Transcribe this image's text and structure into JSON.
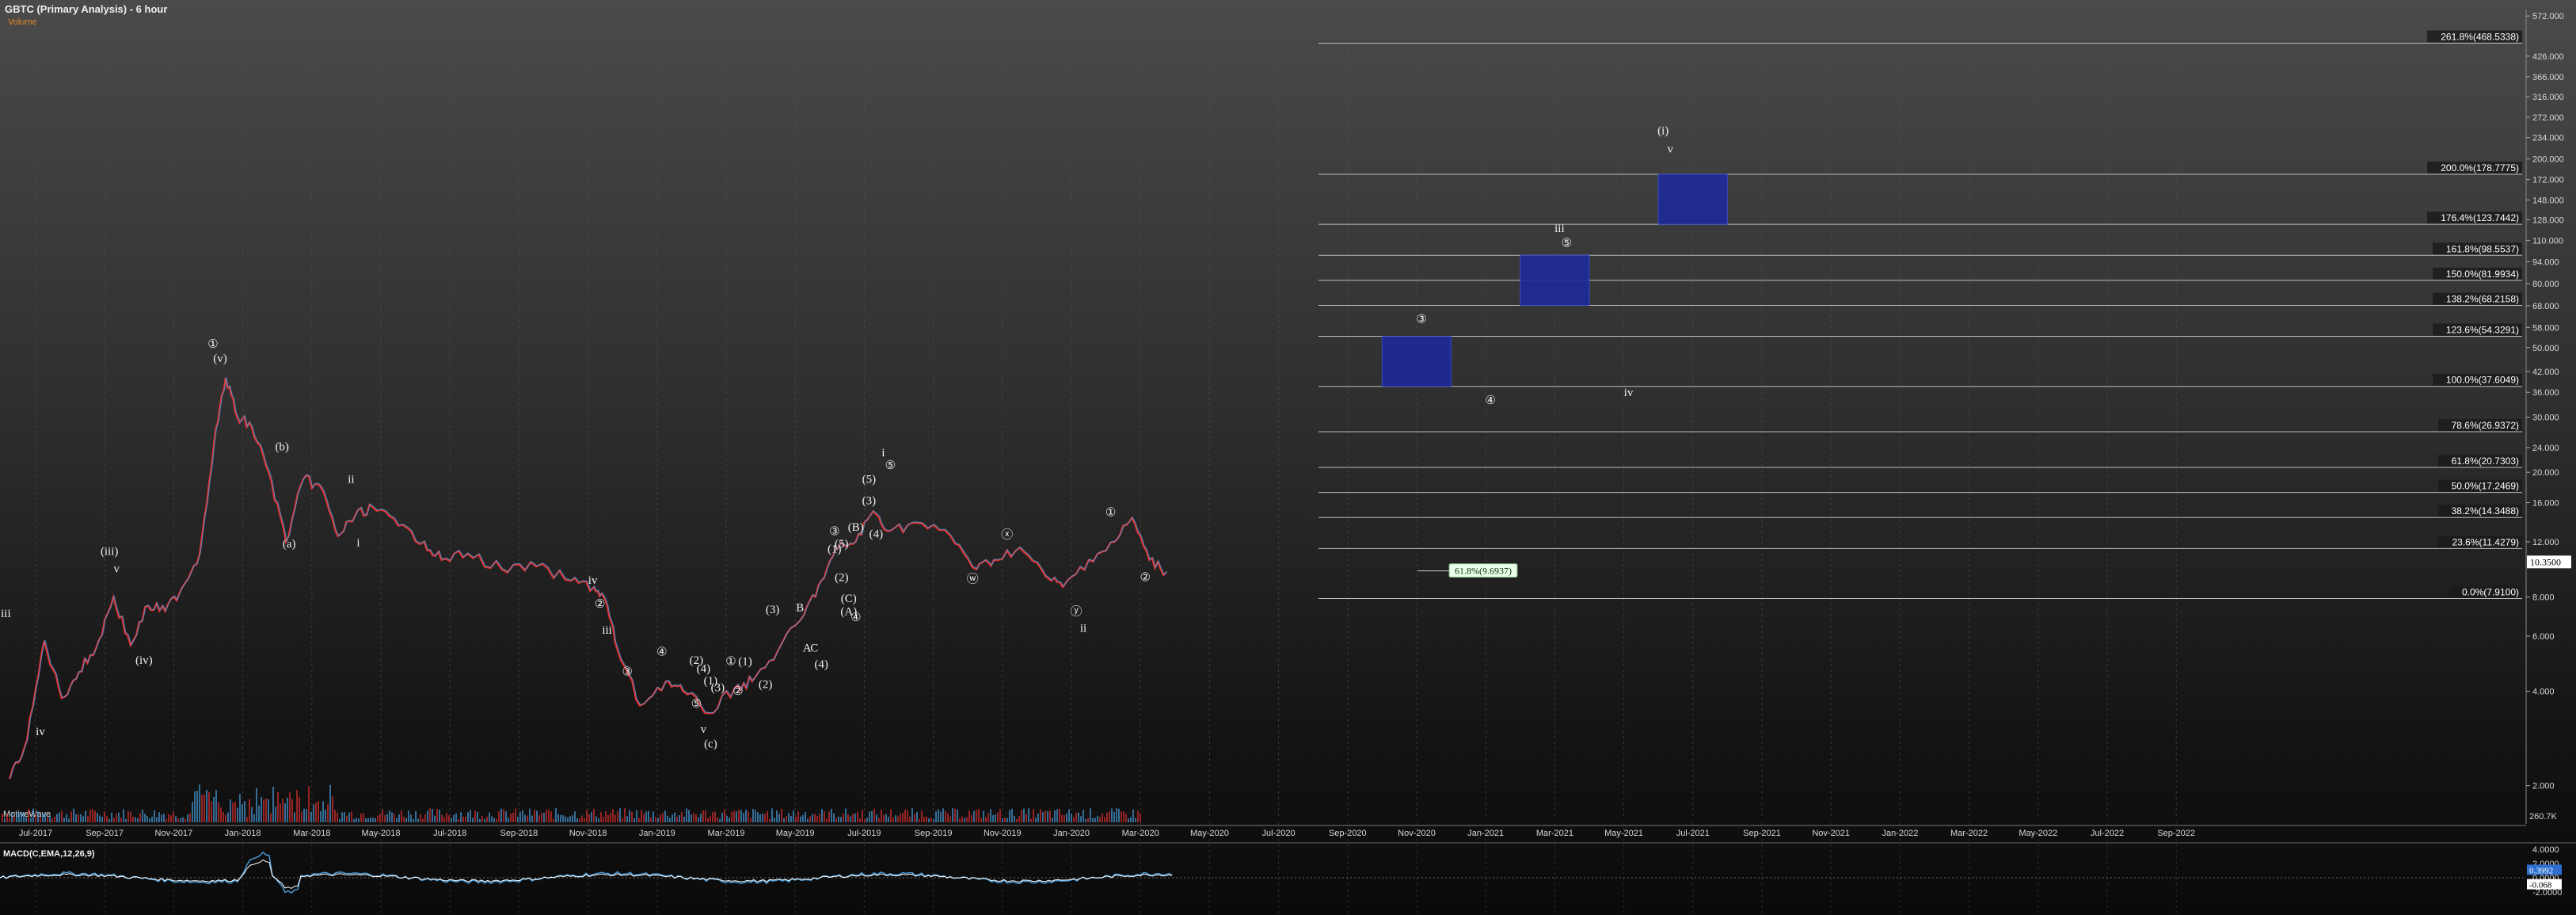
{
  "header": {
    "title": "GBTC (Primary Analysis) - 6 hour",
    "subtitle": "Volume",
    "volume_label": "MotiveWave",
    "macd_label": "MACD(C,EMA,12,26,9)"
  },
  "colors": {
    "up": "#4aa0e0",
    "down": "#e03030",
    "grid": "#555555",
    "fib_line": "#bbbbbb",
    "target_box": "#1e2a9a",
    "macd_line": "#4aa0e0",
    "signal_line": "#ffffff",
    "text": "#f0f0f0"
  },
  "chart_data": {
    "type": "line",
    "scale": "log",
    "ylim": [
      1.6,
      600
    ],
    "y_ticks": [
      "572.000",
      "426.000",
      "366.000",
      "316.000",
      "272.000",
      "234.000",
      "200.000",
      "172.000",
      "148.000",
      "128.000",
      "110.000",
      "94.000",
      "80.000",
      "68.000",
      "58.000",
      "50.000",
      "42.000",
      "36.000",
      "30.000",
      "24.000",
      "20.000",
      "16.000",
      "12.000",
      "8.000",
      "6.000",
      "4.000",
      "2.000"
    ],
    "y_tick_values": [
      572,
      426,
      366,
      316,
      272,
      234,
      200,
      172,
      148,
      128,
      110,
      94,
      80,
      68,
      58,
      50,
      42,
      36,
      30,
      24,
      20,
      16,
      12,
      8,
      6,
      4,
      2
    ],
    "x_axis_months": [
      "Jul-2017",
      "Sep-2017",
      "Nov-2017",
      "Jan-2018",
      "Mar-2018",
      "May-2018",
      "Jul-2018",
      "Sep-2018",
      "Nov-2018",
      "Jan-2019",
      "Mar-2019",
      "May-2019",
      "Jul-2019",
      "Sep-2019",
      "Nov-2019",
      "Jan-2020",
      "Mar-2020",
      "May-2020",
      "Jul-2020",
      "Sep-2020",
      "Nov-2020",
      "Jan-2021",
      "Mar-2021",
      "May-2021",
      "Jul-2021",
      "Sep-2021",
      "Nov-2021",
      "Jan-2022",
      "Mar-2022",
      "May-2022",
      "Jul-2022",
      "Sep-2022"
    ],
    "price_series": {
      "name": "GBTC",
      "points": [
        [
          "Jun-2017",
          2.1
        ],
        [
          "Jun-2017",
          2.8
        ],
        [
          "Jul-2017",
          5.8
        ],
        [
          "Jul-2017",
          3.8
        ],
        [
          "Aug-2017",
          4.6
        ],
        [
          "Aug-2017",
          5.5
        ],
        [
          "Sep-2017",
          8.0
        ],
        [
          "Sep-2017",
          5.6
        ],
        [
          "Oct-2017",
          7.5
        ],
        [
          "Oct-2017",
          7.2
        ],
        [
          "Nov-2017",
          8.6
        ],
        [
          "Nov-2017",
          11.0
        ],
        [
          "Dec-2017",
          25.0
        ],
        [
          "Dec-2017",
          40.0
        ],
        [
          "Dec-2017",
          30.0
        ],
        [
          "Jan-2018",
          28.0
        ],
        [
          "Jan-2018",
          20.0
        ],
        [
          "Feb-2018",
          12.0
        ],
        [
          "Feb-2018",
          19.0
        ],
        [
          "Mar-2018",
          18.0
        ],
        [
          "Mar-2018",
          12.5
        ],
        [
          "Apr-2018",
          14.5
        ],
        [
          "Apr-2018",
          15.5
        ],
        [
          "May-2018",
          13.5
        ],
        [
          "Jun-2018",
          12.0
        ],
        [
          "Jun-2018",
          10.5
        ],
        [
          "Jul-2018",
          11.0
        ],
        [
          "Aug-2018",
          9.8
        ],
        [
          "Sep-2018",
          10.0
        ],
        [
          "Oct-2018",
          9.0
        ],
        [
          "Nov-2018",
          8.6
        ],
        [
          "Nov-2018",
          7.8
        ],
        [
          "Nov-2018",
          5.5
        ],
        [
          "Dec-2018",
          3.6
        ],
        [
          "Jan-2019",
          4.3
        ],
        [
          "Jan-2019",
          4.0
        ],
        [
          "Feb-2019",
          3.4
        ],
        [
          "Mar-2019",
          4.1
        ],
        [
          "Mar-2019",
          4.3
        ],
        [
          "Apr-2019",
          5.4
        ],
        [
          "May-2019",
          7.0
        ],
        [
          "May-2019",
          9.0
        ],
        [
          "Jun-2019",
          11.5
        ],
        [
          "Jun-2019",
          12.0
        ],
        [
          "Jul-2019",
          15.0
        ],
        [
          "Jul-2019",
          13.0
        ],
        [
          "Aug-2019",
          13.8
        ],
        [
          "Sep-2019",
          12.5
        ],
        [
          "Oct-2019",
          9.8
        ],
        [
          "Oct-2019",
          10.5
        ],
        [
          "Nov-2019",
          11.5
        ],
        [
          "Dec-2019",
          9.3
        ],
        [
          "Dec-2019",
          8.6
        ],
        [
          "Jan-2020",
          10.5
        ],
        [
          "Feb-2020",
          12.0
        ],
        [
          "Feb-2020",
          14.3
        ],
        [
          "Mar-2020",
          10.5
        ],
        [
          "Mar-2020",
          9.6
        ]
      ]
    },
    "fib_levels": [
      {
        "label": "261.8%(468.5338)",
        "value": 468.5338
      },
      {
        "label": "200.0%(178.7775)",
        "value": 178.7775
      },
      {
        "label": "176.4%(123.7442)",
        "value": 123.7442
      },
      {
        "label": "161.8%(98.5537)",
        "value": 98.5537
      },
      {
        "label": "150.0%(81.9934)",
        "value": 81.9934
      },
      {
        "label": "138.2%(68.2158)",
        "value": 68.2158
      },
      {
        "label": "123.6%(54.3291)",
        "value": 54.3291
      },
      {
        "label": "100.0%(37.6049)",
        "value": 37.6049
      },
      {
        "label": "78.6%(26.9372)",
        "value": 26.9372
      },
      {
        "label": "61.8%(20.7303)",
        "value": 20.7303
      },
      {
        "label": "50.0%(17.2469)",
        "value": 17.2469
      },
      {
        "label": "38.2%(14.3488)",
        "value": 14.3488
      },
      {
        "label": "23.6%(11.4279)",
        "value": 11.4279
      },
      {
        "label": "0.0%(7.9100)",
        "value": 7.91
      }
    ],
    "retrace_label": {
      "label": "61.8%(9.6937)",
      "value": 9.6937
    },
    "current_price": {
      "label": "10.3500",
      "value": 10.35
    },
    "target_boxes": [
      {
        "wave": "③",
        "start": "Oct-2020",
        "end": "Dec-2020",
        "low": 37.6,
        "high": 54.3
      },
      {
        "wave": "⑤",
        "start": "Feb-2021",
        "end": "Apr-2021",
        "low": 68.2,
        "high": 98.6
      },
      {
        "wave": "v",
        "start": "Jun-2021",
        "end": "Aug-2021",
        "low": 123.7,
        "high": 178.8
      }
    ],
    "wave_labels": [
      {
        "text": "iii",
        "date": "Jun-2017",
        "value": 6.9
      },
      {
        "text": "iv",
        "date": "Jul-2017",
        "value": 2.9
      },
      {
        "text": "(iii)",
        "date": "Sep-2017",
        "value": 10.9
      },
      {
        "text": "v",
        "date": "Sep-2017",
        "value": 9.6
      },
      {
        "text": "(iv)",
        "date": "Oct-2017",
        "value": 4.9
      },
      {
        "text": "①",
        "date": "Dec-2017",
        "value": 50.0
      },
      {
        "text": "(v)",
        "date": "Dec-2017",
        "value": 45.0
      },
      {
        "text": "(b)",
        "date": "Feb-2018",
        "value": 23.5
      },
      {
        "text": "(a)",
        "date": "Feb-2018",
        "value": 11.5
      },
      {
        "text": "ii",
        "date": "Apr-2018",
        "value": 18.5
      },
      {
        "text": "i",
        "date": "Apr-2018",
        "value": 11.6
      },
      {
        "text": "iv",
        "date": "Nov-2018",
        "value": 8.8
      },
      {
        "text": "②",
        "date": "Nov-2018",
        "value": 7.4
      },
      {
        "text": "iii",
        "date": "Nov-2018",
        "value": 6.1
      },
      {
        "text": "③",
        "date": "Dec-2018",
        "value": 4.5
      },
      {
        "text": "④",
        "date": "Jan-2019",
        "value": 5.2
      },
      {
        "text": "(2)",
        "date": "Feb-2019",
        "value": 4.9
      },
      {
        "text": "(4)",
        "date": "Feb-2019",
        "value": 4.6
      },
      {
        "text": "(1)",
        "date": "Feb-2019",
        "value": 4.2
      },
      {
        "text": "(3)",
        "date": "Feb-2019",
        "value": 4.0
      },
      {
        "text": "⑤",
        "date": "Feb-2019",
        "value": 3.55
      },
      {
        "text": "v",
        "date": "Feb-2019",
        "value": 2.95
      },
      {
        "text": "(c)",
        "date": "Feb-2019",
        "value": 2.65
      },
      {
        "text": "①",
        "date": "Mar-2019",
        "value": 4.85
      },
      {
        "text": "②",
        "date": "Mar-2019",
        "value": 3.9
      },
      {
        "text": "(1)",
        "date": "Mar-2019",
        "value": 4.85
      },
      {
        "text": "(2)",
        "date": "Apr-2019",
        "value": 4.1
      },
      {
        "text": "(3)",
        "date": "Apr-2019",
        "value": 7.1
      },
      {
        "text": "B",
        "date": "May-2019",
        "value": 7.2
      },
      {
        "text": "A",
        "date": "May-2019",
        "value": 5.35
      },
      {
        "text": "C",
        "date": "May-2019",
        "value": 5.35
      },
      {
        "text": "(4)",
        "date": "May-2019",
        "value": 4.75
      },
      {
        "text": "③",
        "date": "Jun-2019",
        "value": 12.6
      },
      {
        "text": "(5)",
        "date": "Jun-2019",
        "value": 11.5
      },
      {
        "text": "(A)",
        "date": "Jun-2019",
        "value": 7.0
      },
      {
        "text": "(B)",
        "date": "Jun-2019",
        "value": 13.0
      },
      {
        "text": "(1)",
        "date": "Jun-2019",
        "value": 11.1
      },
      {
        "text": "(2)",
        "date": "Jun-2019",
        "value": 9.0
      },
      {
        "text": "(C)",
        "date": "Jun-2019",
        "value": 7.7
      },
      {
        "text": "④",
        "date": "Jun-2019",
        "value": 6.7
      },
      {
        "text": "(3)",
        "date": "Jul-2019",
        "value": 15.8
      },
      {
        "text": "(4)",
        "date": "Jul-2019",
        "value": 12.4
      },
      {
        "text": "i",
        "date": "Jul-2019",
        "value": 22.5
      },
      {
        "text": "⑤",
        "date": "Jul-2019",
        "value": 20.5
      },
      {
        "text": "(5)",
        "date": "Jul-2019",
        "value": 18.5
      },
      {
        "text": "ⓦ",
        "date": "Oct-2019",
        "value": 8.9
      },
      {
        "text": "ⓧ",
        "date": "Nov-2019",
        "value": 12.3
      },
      {
        "text": "ⓨ",
        "date": "Jan-2020",
        "value": 7.0
      },
      {
        "text": "ii",
        "date": "Jan-2020",
        "value": 6.2
      },
      {
        "text": "①",
        "date": "Feb-2020",
        "value": 14.5
      },
      {
        "text": "②",
        "date": "Mar-2020",
        "value": 9.0
      },
      {
        "text": "③",
        "date": "Nov-2020",
        "value": 60.0
      },
      {
        "text": "④",
        "date": "Jan-2021",
        "value": 33.0
      },
      {
        "text": "iii",
        "date": "Mar-2021",
        "value": 117.0
      },
      {
        "text": "⑤",
        "date": "Mar-2021",
        "value": 105.0
      },
      {
        "text": "iv",
        "date": "May-2021",
        "value": 35.0
      },
      {
        "text": "(i)",
        "date": "Jun-2021",
        "value": 240.0
      },
      {
        "text": "v",
        "date": "Jun-2021",
        "value": 210.0
      }
    ],
    "volume": {
      "label": "260.7K",
      "value": 260.7
    },
    "macd": {
      "ticks": [
        "4.0000",
        "2.0000",
        "0.0000",
        "-2.0000"
      ],
      "tick_values": [
        4,
        2,
        0,
        -2
      ],
      "readout": "0.3992",
      "readout_value": 0.3992,
      "readout2": "-0.068",
      "readout2_value": -0.068
    }
  }
}
